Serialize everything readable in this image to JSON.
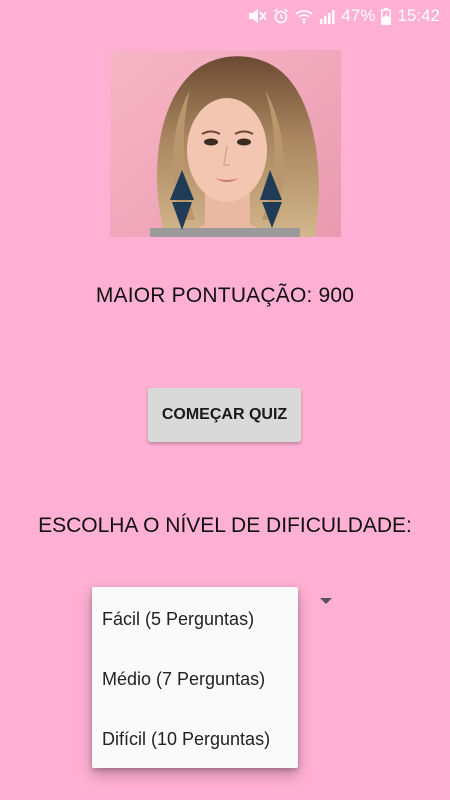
{
  "status_bar": {
    "battery_percent": "47%",
    "time": "15:42",
    "icons": [
      "mute-icon",
      "alarm-icon",
      "wifi-icon",
      "signal-icon",
      "battery-charging-icon"
    ]
  },
  "main": {
    "highscore_label": "MAIOR PONTUAÇÃO:",
    "highscore_value": "900",
    "start_button_label": "COMEÇAR QUIZ",
    "difficulty_label": "ESCOLHA O NÍVEL DE DIFICULDADE:"
  },
  "difficulty_dropdown": {
    "options": [
      "Fácil (5 Perguntas)",
      "Médio (7 Perguntas)",
      "Difícil (10 Perguntas)"
    ]
  },
  "colors": {
    "background": "#FFB0D3",
    "button": "#D9D9D9",
    "dropdown": "#FAFAFA"
  }
}
